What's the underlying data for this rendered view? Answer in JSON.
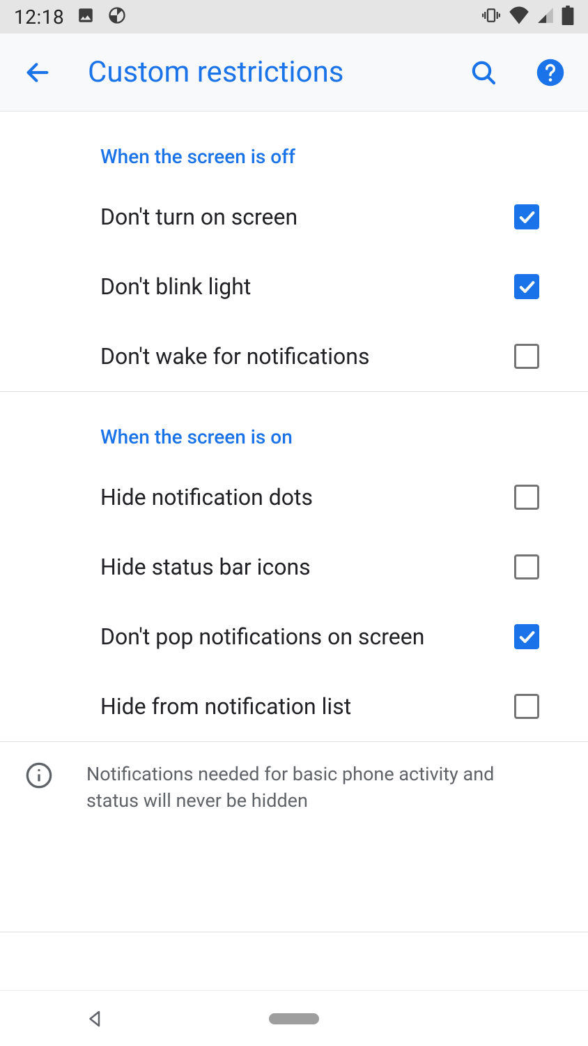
{
  "status": {
    "time": "12:18"
  },
  "header": {
    "title": "Custom restrictions"
  },
  "sections": [
    {
      "title": "When the screen is off",
      "items": [
        {
          "label": "Don't turn on screen",
          "checked": true,
          "key": "dont-turn-on-screen"
        },
        {
          "label": "Don't blink light",
          "checked": true,
          "key": "dont-blink-light"
        },
        {
          "label": "Don't wake for notifications",
          "checked": false,
          "key": "dont-wake-for-notifications"
        }
      ]
    },
    {
      "title": "When the screen is on",
      "items": [
        {
          "label": "Hide notification dots",
          "checked": false,
          "key": "hide-notification-dots"
        },
        {
          "label": "Hide status bar icons",
          "checked": false,
          "key": "hide-status-bar-icons"
        },
        {
          "label": "Don't pop notifications on screen",
          "checked": true,
          "key": "dont-pop-notifications"
        },
        {
          "label": "Hide from notification list",
          "checked": false,
          "key": "hide-from-notification-list"
        }
      ]
    }
  ],
  "info": {
    "text": "Notifications needed for basic phone activity and status will never be hidden"
  }
}
